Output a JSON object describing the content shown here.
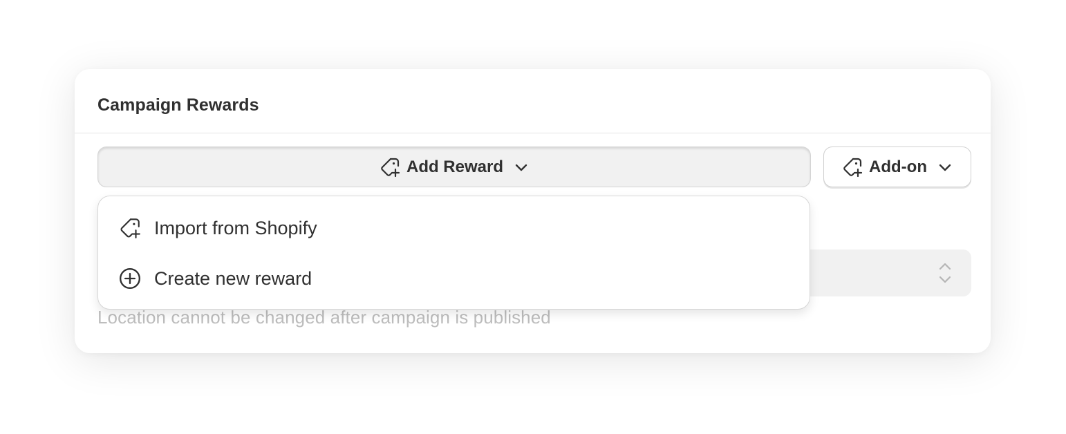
{
  "card": {
    "title": "Campaign Rewards",
    "help_text": "Location cannot be changed after campaign is published"
  },
  "toolbar": {
    "add_reward_label": "Add Reward",
    "addon_label": "Add-on",
    "add_reward_icon": "tag-plus-icon",
    "addon_icon": "tag-plus-icon",
    "chevron_icon": "chevron-down-icon"
  },
  "menu": {
    "items": [
      {
        "label": "Import from Shopify",
        "icon": "tag-plus-icon"
      },
      {
        "label": "Create new reward",
        "icon": "circle-plus-icon"
      }
    ]
  },
  "select": {
    "value": "",
    "icon": "select-updown-icon"
  },
  "colors": {
    "text": "#303030",
    "muted": "#bdbdbd",
    "button_pressed_bg": "#f1f1f1",
    "border": "#d6d6d6"
  }
}
